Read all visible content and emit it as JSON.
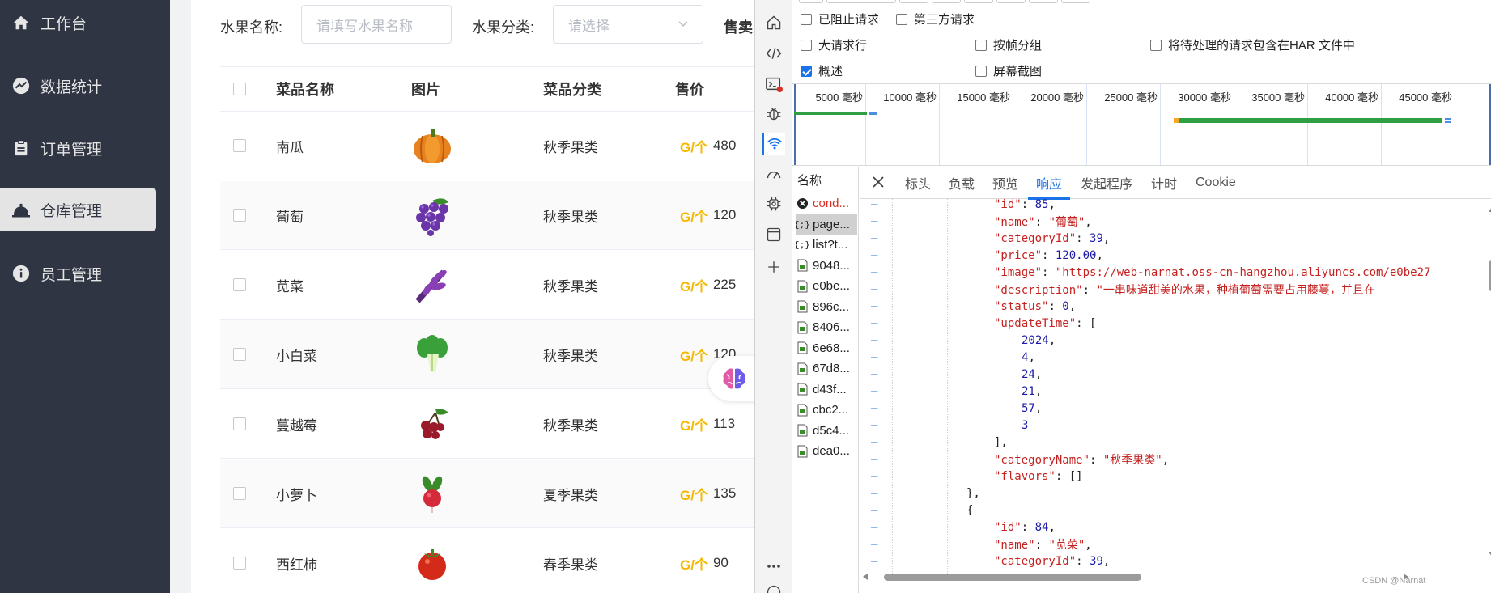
{
  "sidebar": {
    "items": [
      {
        "label": "工作台",
        "icon": "home-icon",
        "active": false
      },
      {
        "label": "数据统计",
        "icon": "chart-icon",
        "active": false
      },
      {
        "label": "订单管理",
        "icon": "clipboard-icon",
        "active": false
      },
      {
        "label": "仓库管理",
        "icon": "bell-icon",
        "active": true
      },
      {
        "label": "员工管理",
        "icon": "info-icon",
        "active": false
      }
    ]
  },
  "filters": {
    "name_label": "水果名称:",
    "name_placeholder": "请填写水果名称",
    "category_label": "水果分类:",
    "category_placeholder": "请选择",
    "status_label": "售卖"
  },
  "table": {
    "headers": [
      "菜品名称",
      "图片",
      "菜品分类",
      "售价"
    ],
    "price_unit": "G/个",
    "rows": [
      {
        "name": "南瓜",
        "category": "秋季果类",
        "price": "480",
        "image": "pumpkin"
      },
      {
        "name": "葡萄",
        "category": "秋季果类",
        "price": "120",
        "image": "grape"
      },
      {
        "name": "苋菜",
        "category": "秋季果类",
        "price": "225",
        "image": "amaranth"
      },
      {
        "name": "小白菜",
        "category": "秋季果类",
        "price": "120",
        "image": "bok-choy"
      },
      {
        "name": "蔓越莓",
        "category": "秋季果类",
        "price": "113",
        "image": "cranberry"
      },
      {
        "name": "小萝卜",
        "category": "夏季果类",
        "price": "135",
        "image": "radish"
      },
      {
        "name": "西红柿",
        "category": "春季果类",
        "price": "90",
        "image": "tomato"
      }
    ]
  },
  "devtools": {
    "options": [
      {
        "label": "已阻止请求",
        "checked": false
      },
      {
        "label": "第三方请求",
        "checked": false
      },
      {
        "label": "大请求行",
        "checked": false
      },
      {
        "label": "按帧分组",
        "checked": false
      },
      {
        "label": "将待处理的请求包含在HAR 文件中",
        "checked": false
      },
      {
        "label": "概述",
        "checked": true
      },
      {
        "label": "屏幕截图",
        "checked": false
      }
    ],
    "timeline_ticks": [
      "5000 毫秒",
      "10000 毫秒",
      "15000 毫秒",
      "20000 毫秒",
      "25000 毫秒",
      "30000 毫秒",
      "35000 毫秒",
      "40000 毫秒",
      "45000 毫秒"
    ],
    "name_header": "名称",
    "requests": [
      {
        "name": "cond...",
        "type": "error"
      },
      {
        "name": "page...",
        "type": "fetch",
        "selected": true
      },
      {
        "name": "list?t...",
        "type": "fetch"
      },
      {
        "name": "9048...",
        "type": "image"
      },
      {
        "name": "e0be...",
        "type": "image"
      },
      {
        "name": "896c...",
        "type": "image"
      },
      {
        "name": "8406...",
        "type": "image"
      },
      {
        "name": "6e68...",
        "type": "image"
      },
      {
        "name": "67d8...",
        "type": "image"
      },
      {
        "name": "d43f...",
        "type": "image"
      },
      {
        "name": "cbc2...",
        "type": "image"
      },
      {
        "name": "d5c4...",
        "type": "image"
      },
      {
        "name": "dea0...",
        "type": "image"
      }
    ],
    "tabs": [
      "标头",
      "负载",
      "预览",
      "响应",
      "发起程序",
      "计时",
      "Cookie"
    ],
    "active_tab": "响应",
    "response_lines": [
      {
        "indent": 5,
        "parts": [
          [
            "k",
            "\"id\""
          ],
          [
            "p",
            ": "
          ],
          [
            "n",
            "85"
          ],
          [
            "p",
            ","
          ]
        ]
      },
      {
        "indent": 5,
        "parts": [
          [
            "k",
            "\"name\""
          ],
          [
            "p",
            ": "
          ],
          [
            "s",
            "\"葡萄\""
          ],
          [
            "p",
            ","
          ]
        ]
      },
      {
        "indent": 5,
        "parts": [
          [
            "k",
            "\"categoryId\""
          ],
          [
            "p",
            ": "
          ],
          [
            "n",
            "39"
          ],
          [
            "p",
            ","
          ]
        ]
      },
      {
        "indent": 5,
        "parts": [
          [
            "k",
            "\"price\""
          ],
          [
            "p",
            ": "
          ],
          [
            "n",
            "120.00"
          ],
          [
            "p",
            ","
          ]
        ]
      },
      {
        "indent": 5,
        "parts": [
          [
            "k",
            "\"image\""
          ],
          [
            "p",
            ": "
          ],
          [
            "s",
            "\"https://web-narnat.oss-cn-hangzhou.aliyuncs.com/e0be27"
          ]
        ]
      },
      {
        "indent": 5,
        "parts": [
          [
            "k",
            "\"description\""
          ],
          [
            "p",
            ": "
          ],
          [
            "s",
            "\"一串味道甜美的水果，种植葡萄需要占用藤蔓，并且在"
          ]
        ]
      },
      {
        "indent": 5,
        "parts": [
          [
            "k",
            "\"status\""
          ],
          [
            "p",
            ": "
          ],
          [
            "n",
            "0"
          ],
          [
            "p",
            ","
          ]
        ]
      },
      {
        "indent": 5,
        "parts": [
          [
            "k",
            "\"updateTime\""
          ],
          [
            "p",
            ": ["
          ]
        ]
      },
      {
        "indent": 6,
        "parts": [
          [
            "n",
            "2024"
          ],
          [
            "p",
            ","
          ]
        ]
      },
      {
        "indent": 6,
        "parts": [
          [
            "n",
            "4"
          ],
          [
            "p",
            ","
          ]
        ]
      },
      {
        "indent": 6,
        "parts": [
          [
            "n",
            "24"
          ],
          [
            "p",
            ","
          ]
        ]
      },
      {
        "indent": 6,
        "parts": [
          [
            "n",
            "21"
          ],
          [
            "p",
            ","
          ]
        ]
      },
      {
        "indent": 6,
        "parts": [
          [
            "n",
            "57"
          ],
          [
            "p",
            ","
          ]
        ]
      },
      {
        "indent": 6,
        "parts": [
          [
            "n",
            "3"
          ]
        ]
      },
      {
        "indent": 5,
        "parts": [
          [
            "p",
            "],"
          ]
        ]
      },
      {
        "indent": 5,
        "parts": [
          [
            "k",
            "\"categoryName\""
          ],
          [
            "p",
            ": "
          ],
          [
            "s",
            "\"秋季果类\""
          ],
          [
            "p",
            ","
          ]
        ]
      },
      {
        "indent": 5,
        "parts": [
          [
            "k",
            "\"flavors\""
          ],
          [
            "p",
            ": []"
          ]
        ]
      },
      {
        "indent": 4,
        "parts": [
          [
            "p",
            "},"
          ]
        ]
      },
      {
        "indent": 4,
        "parts": [
          [
            "p",
            "{"
          ]
        ]
      },
      {
        "indent": 5,
        "parts": [
          [
            "k",
            "\"id\""
          ],
          [
            "p",
            ": "
          ],
          [
            "n",
            "84"
          ],
          [
            "p",
            ","
          ]
        ]
      },
      {
        "indent": 5,
        "parts": [
          [
            "k",
            "\"name\""
          ],
          [
            "p",
            ": "
          ],
          [
            "s",
            "\"苋菜\""
          ],
          [
            "p",
            ","
          ]
        ]
      },
      {
        "indent": 5,
        "parts": [
          [
            "k",
            "\"categoryId\""
          ],
          [
            "p",
            ": "
          ],
          [
            "n",
            "39"
          ],
          [
            "p",
            ","
          ]
        ]
      }
    ],
    "watermark": "CSDN @Narnat"
  }
}
